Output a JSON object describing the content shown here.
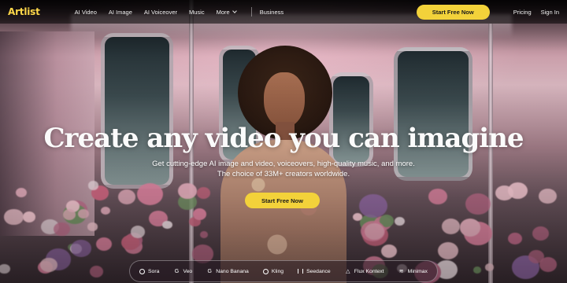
{
  "brand": {
    "logo": "Artlist",
    "accent": "#f3d23a",
    "logo_color": "#ffd84a"
  },
  "nav": {
    "links": [
      "AI Video",
      "AI Image",
      "AI Voiceover",
      "Music",
      "More"
    ],
    "business": "Business",
    "cta": "Start Free Now",
    "pricing": "Pricing",
    "signin": "Sign In"
  },
  "hero": {
    "headline": "Create any video you can imagine",
    "sub_line1": "Get cutting-edge AI image and video, voiceovers, high-quality music, and more.",
    "sub_line2": "The choice of 33M+ creators worldwide.",
    "cta": "Start Free Now"
  },
  "models": [
    {
      "label": "Sora",
      "icon": "openai-icon"
    },
    {
      "label": "Veo",
      "icon": "google-icon"
    },
    {
      "label": "Nano Banana",
      "icon": "google-icon"
    },
    {
      "label": "Kling",
      "icon": "kling-icon"
    },
    {
      "label": "Seedance",
      "icon": "bars-icon"
    },
    {
      "label": "Flux Kontext",
      "icon": "flux-icon"
    },
    {
      "label": "Minimax",
      "icon": "wave-icon"
    }
  ]
}
